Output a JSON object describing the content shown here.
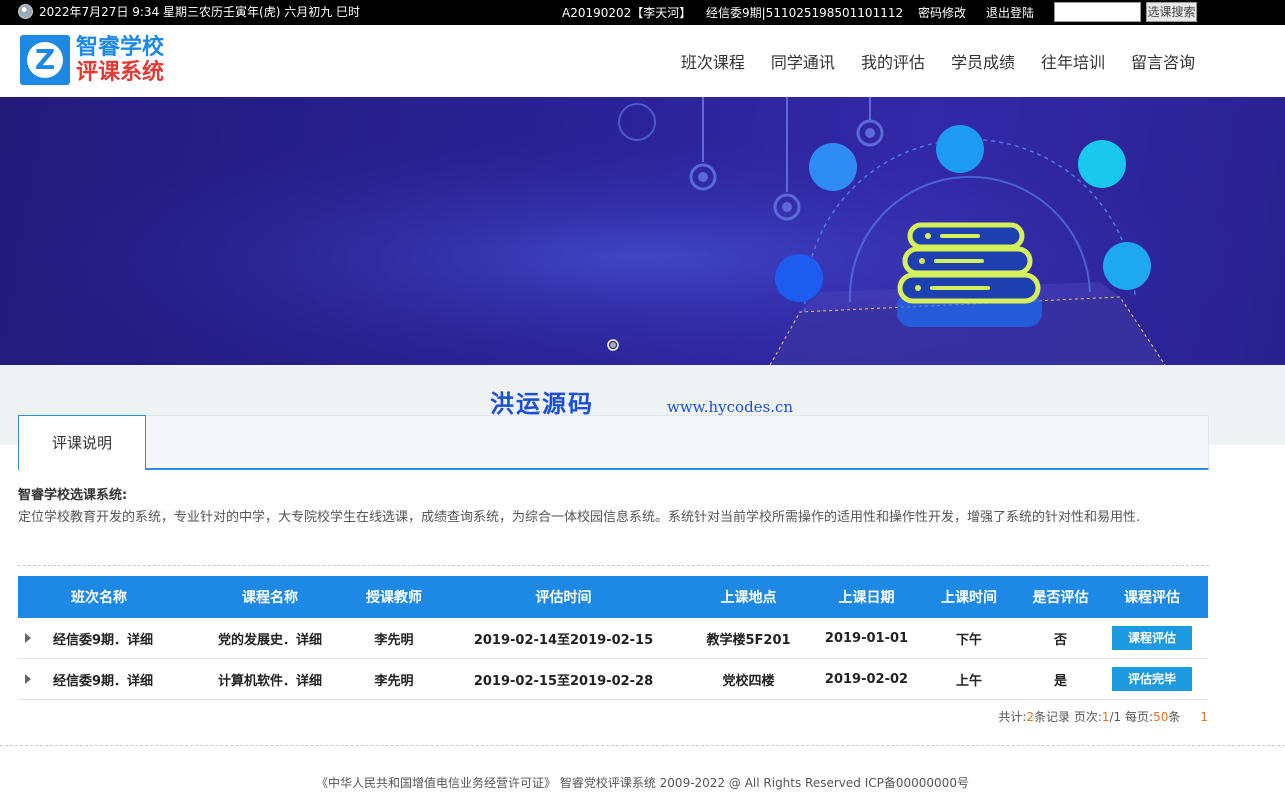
{
  "topbar": {
    "datetime": "2022年7月27日 9:34 星期三农历壬寅年(虎) 六月初九 巳时",
    "user_code": "A20190202【李天河】",
    "class_id": "经信委9期|511025198501101112",
    "change_password": "密码修改",
    "logout": "退出登陆",
    "search_placeholder": "",
    "search_button": "选课搜索"
  },
  "header": {
    "logo_letter": "Z",
    "logo_line1": "智睿学校",
    "logo_line2": "评课系统",
    "nav": [
      "班次课程",
      "同学通讯",
      "我的评估",
      "学员成绩",
      "往年培训",
      "留言咨询"
    ]
  },
  "watermark": {
    "name": "洪运源码",
    "url": "www.hycodes.cn"
  },
  "tabs": {
    "active": "评课说明"
  },
  "description": {
    "title": "智睿学校选课系统:",
    "text": "定位学校教育开发的系统，专业针对的中学，大专院校学生在线选课，成绩查询系统，为综合一体校园信息系统。系统针对当前学校所需操作的适用性和操作性开发，增强了系统的针对性和易用性."
  },
  "table": {
    "headers": [
      "班次名称",
      "课程名称",
      "授课教师",
      "评估时间",
      "上课地点",
      "上课日期",
      "上课时间",
      "是否评估",
      "课程评估"
    ],
    "rows": [
      {
        "class_name": "经信委9期．详细",
        "course": "党的发展史．详细",
        "teacher": "李先明",
        "eval_time": "2019-02-14至2019-02-15",
        "location": "教学楼5F201",
        "date": "2019-01-01",
        "time": "下午",
        "evaluated": "否",
        "action": "课程评估"
      },
      {
        "class_name": "经信委9期．详细",
        "course": "计算机软件．详细",
        "teacher": "李先明",
        "eval_time": "2019-02-15至2019-02-28",
        "location": "党校四楼",
        "date": "2019-02-02",
        "time": "上午",
        "evaluated": "是",
        "action": "评估完毕"
      }
    ]
  },
  "pager": {
    "total_label": "共计:",
    "total": "2",
    "records_label": "条记录 页次:",
    "page": "1",
    "pages": "/1",
    "per_page_label": " 每页:",
    "per_page": "50",
    "unit": "条",
    "page_link": "1"
  },
  "footer": {
    "text": "《中华人民共和国增值电信业务经营许可证》 智睿党校评课系统 2009-2022 @ All Rights Reserved   ICP备00000000号"
  }
}
